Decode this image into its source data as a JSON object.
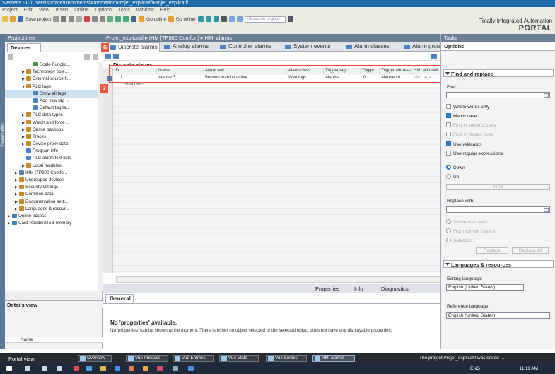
{
  "window": {
    "title": "Siemens - C:\\Users\\surface\\Documents\\Automation\\Projet_explicatif\\Projet_explicatif"
  },
  "menu": [
    "Project",
    "Edit",
    "View",
    "Insert",
    "Online",
    "Options",
    "Tools",
    "Window",
    "Help"
  ],
  "toolbar": {
    "save_label": "Save project",
    "go_online": "Go online",
    "go_offline": "Go offline",
    "search_placeholder": "<Search in project>"
  },
  "brand": {
    "line1": "Totally Integrated Automation",
    "line2": "PORTAL"
  },
  "project_tree": {
    "header": "Project tree",
    "tab": "Devices",
    "items": [
      {
        "label": "Scale Functio...",
        "indent": 3,
        "color": "#3c9a3c",
        "arrow": ""
      },
      {
        "label": "Technology obje...",
        "indent": 2,
        "color": "#c78a2a",
        "arrow": "▶"
      },
      {
        "label": "External source fi...",
        "indent": 2,
        "color": "#c78a2a",
        "arrow": "▶"
      },
      {
        "label": "PLC tags",
        "indent": 2,
        "color": "#c78a2a",
        "arrow": "▼"
      },
      {
        "label": "Show all tags",
        "indent": 3,
        "color": "#4a84c6",
        "arrow": "",
        "selected": true
      },
      {
        "label": "Add new tag ...",
        "indent": 3,
        "color": "#4a84c6",
        "arrow": ""
      },
      {
        "label": "Default tag ta...",
        "indent": 3,
        "color": "#4a84c6",
        "arrow": ""
      },
      {
        "label": "PLC data types",
        "indent": 2,
        "color": "#c78a2a",
        "arrow": "▶"
      },
      {
        "label": "Watch and force ...",
        "indent": 2,
        "color": "#c78a2a",
        "arrow": "▶"
      },
      {
        "label": "Online backups",
        "indent": 2,
        "color": "#c78a2a",
        "arrow": "▶"
      },
      {
        "label": "Traces",
        "indent": 2,
        "color": "#c78a2a",
        "arrow": "▶"
      },
      {
        "label": "Device proxy data",
        "indent": 2,
        "color": "#c78a2a",
        "arrow": "▶"
      },
      {
        "label": "Program info",
        "indent": 2,
        "color": "#4a84c6",
        "arrow": ""
      },
      {
        "label": "PLC alarm text lists",
        "indent": 2,
        "color": "#4a84c6",
        "arrow": ""
      },
      {
        "label": "Local modules",
        "indent": 2,
        "color": "#c78a2a",
        "arrow": "▶"
      },
      {
        "label": "IHM [TP900 Comfo...",
        "indent": 1,
        "color": "#5a7ea8",
        "arrow": "▶"
      },
      {
        "label": "Ungrouped devices",
        "indent": 1,
        "color": "#c78a2a",
        "arrow": "▶"
      },
      {
        "label": "Security settings",
        "indent": 1,
        "color": "#c78a2a",
        "arrow": "▶"
      },
      {
        "label": "Common data",
        "indent": 1,
        "color": "#c78a2a",
        "arrow": "▶"
      },
      {
        "label": "Documentation setti...",
        "indent": 1,
        "color": "#c78a2a",
        "arrow": "▶"
      },
      {
        "label": "Languages & resour...",
        "indent": 1,
        "color": "#c78a2a",
        "arrow": "▶"
      },
      {
        "label": "Online access",
        "indent": 0,
        "color": "#3c7fc0",
        "arrow": "▶"
      },
      {
        "label": "Card Reader/USB memory",
        "indent": 0,
        "color": "#3c7fc0",
        "arrow": "▶"
      }
    ],
    "details_view": "Details view",
    "details_column": "Name",
    "side_tab": "Visualization"
  },
  "editor": {
    "breadcrumb": "Projet_explicatif ▸ IHM [TP900 Comfort] ▸ HMI alarms",
    "tabs": [
      "Discrete alarms",
      "Analog alarms",
      "Controller alarms",
      "System events",
      "Alarm classes",
      "Alarm groups"
    ],
    "grid_title": "Discrete alarms",
    "columns": [
      "ID",
      "Name",
      "Alarm text",
      "Alarm class",
      "Trigger tag",
      "Trigge...",
      "Trigger address",
      "HMI acknowl..."
    ],
    "rows": [
      {
        "id": "1",
        "name": "Alarme 3",
        "text": "Boutton marche active",
        "class": "Warnings",
        "tag": "Alarme",
        "bit": "0",
        "address": "Alarme.x0",
        "ack": "<No tag>"
      }
    ],
    "add_new": "<Add new>",
    "callouts": [
      "6",
      "7"
    ]
  },
  "inspector": {
    "tabs": {
      "properties": "Properties",
      "info": "Info",
      "diagnostics": "Diagnostics"
    },
    "general": "General",
    "title": "No 'properties' available.",
    "text": "No 'properties' can be shown at the moment. There is either no object selected or the selected object does not have any displayable properties."
  },
  "tasks": {
    "header": "Tasks",
    "options": "Options",
    "find_replace": "Find and replace",
    "find_label": "Find:",
    "checks": [
      {
        "label": "Whole words only",
        "checked": false,
        "enabled": true
      },
      {
        "label": "Match case",
        "checked": true,
        "enabled": true
      },
      {
        "label": "Find in substructures",
        "checked": false,
        "enabled": false
      },
      {
        "label": "Find in hidden texts",
        "checked": false,
        "enabled": false
      },
      {
        "label": "Use wildcards",
        "checked": true,
        "enabled": true
      },
      {
        "label": "Use regular expressions",
        "checked": false,
        "enabled": true
      }
    ],
    "radio_down": "Down",
    "radio_up": "Up",
    "find_btn": "Find",
    "replace_label": "Replace with:",
    "replace_opts": [
      "Whole document",
      "From current position",
      "Selection"
    ],
    "replace_btn": "Replace",
    "replace_all_btn": "Replace all",
    "lang_section": "Languages & resources",
    "editing_label": "Editing language:",
    "editing_value": "English (United States)",
    "reference_label": "Reference language:",
    "reference_value": "English (United States)"
  },
  "portal": {
    "portal_view": "Portal view",
    "tasks": [
      "Overview",
      "Vue Pricipale",
      "Vue Entrees",
      "Vue Etats",
      "Vue Sorties",
      "HMI alarms"
    ],
    "saved": "The project Projet_explicatif was saved ..."
  },
  "taskbar": {
    "lang": "ENG",
    "time": "11:11 AM"
  }
}
